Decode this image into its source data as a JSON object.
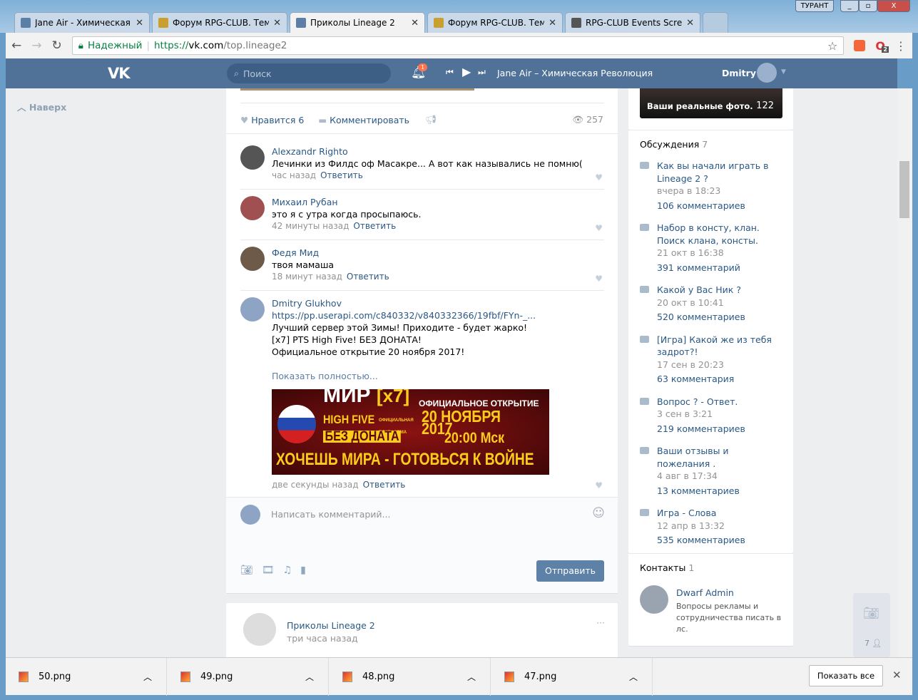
{
  "window": {
    "badge": "ТУРАНТ",
    "min": "_",
    "max": "▫",
    "close": "X"
  },
  "tabs": [
    {
      "title": "Jane Air - Химическая Р",
      "close": "✕"
    },
    {
      "title": "Форум RPG-CLUB. Тема",
      "close": "✕"
    },
    {
      "title": "Приколы Lineage 2",
      "close": "✕"
    },
    {
      "title": "Форум RPG-CLUB. Тема",
      "close": "✕"
    },
    {
      "title": "RPG-CLUB Events Screen",
      "close": "✕"
    }
  ],
  "address": {
    "secure_label": "Надежный",
    "url_scheme": "https://",
    "url_host": "vk.com",
    "url_path": "/top.lineage2",
    "ext_badge": "2"
  },
  "vk": {
    "logo": "VK",
    "search_placeholder": "Поиск",
    "notif_count": "1",
    "track": "Jane Air – Химическая Революция",
    "user": "Dmitry",
    "back_to_top": "Наверх"
  },
  "post": {
    "like_label": "Нравится",
    "like_count": "6",
    "comment_label": "Комментировать",
    "views": "257"
  },
  "comments": [
    {
      "name": "Alexzandr Righto",
      "text": "Лечинки из Филдс оф Масакре... А вот как назывались не помню(",
      "time": "час назад",
      "reply": "Ответить"
    },
    {
      "name": "Михаил Рубан",
      "text": "это я с утра когда просыпаюсь.",
      "time": "42 минуты назад",
      "reply": "Ответить"
    },
    {
      "name": "Федя Мид",
      "text": "твоя мамаша",
      "time": "18 минут назад",
      "reply": "Ответить"
    },
    {
      "name": "Dmitry Glukhov",
      "link": "https://pp.userapi.com/c840332/v840332366/19fbf/FYn-_...",
      "lines": [
        "Лучший сервер этой Зимы! Приходите - будет жарко!",
        "[x7] PTS High Five! БЕЗ ДОНАТА!",
        "Официальное открытие 20 ноября 2017!"
      ],
      "more": "Показать полностью...",
      "time": "две секунды назад",
      "reply": "Ответить"
    }
  ],
  "banner": {
    "mir": "МИР",
    "x7": "[x7]",
    "hf": "HIGH FIVE",
    "platform": "ОФИЦИАЛЬНАЯ ПЛАТФОРМА",
    "nodonate": "БЕЗ ДОНАТА",
    "opening": "ОФИЦИАЛЬНОЕ ОТКРЫТИЕ",
    "date": "20 НОЯБРЯ 2017",
    "time": "20:00 Мск",
    "slogan": "ХОЧЕШЬ МИРА - ГОТОВЬСЯ К ВОЙНЕ"
  },
  "composer": {
    "placeholder": "Написать комментарий...",
    "send": "Отправить"
  },
  "next_post": {
    "author": "Приколы Lineage 2",
    "time": "три часа назад",
    "menu": "···"
  },
  "album": {
    "title": "Ваши реальные фото.",
    "count": "122"
  },
  "discussions": {
    "title": "Обсуждения",
    "count": "7",
    "items": [
      {
        "title": "Как вы начали играть в Lineage 2 ?",
        "date": "вчера в 18:23",
        "comments": "106 комментариев"
      },
      {
        "title": "Набор в консту, клан. Поиск клана, консты.",
        "date": "21 окт в 16:38",
        "comments": "391 комментарий"
      },
      {
        "title": "Какой у Вас Ник ?",
        "date": "20 окт в 10:41",
        "comments": "520 комментариев"
      },
      {
        "title": "[Игра] Какой же из тебя задрот?!",
        "date": "17 сен в 20:23",
        "comments": "63 комментария"
      },
      {
        "title": "Вопрос ? - Ответ.",
        "date": "3 сен в 3:21",
        "comments": "219 комментариев"
      },
      {
        "title": "Ваши отзывы и пожелания .",
        "date": "4 авг в 17:34",
        "comments": "13 комментариев"
      },
      {
        "title": "Игра - Слова",
        "date": "12 апр в 13:32",
        "comments": "535 комментариев"
      }
    ]
  },
  "contacts": {
    "title": "Контакты",
    "count": "1",
    "name": "Dwarf Admin",
    "desc": "Вопросы рекламы и сотрудничества писать в лс."
  },
  "side_widget": {
    "count": "7"
  },
  "downloads": {
    "items": [
      "50.png",
      "49.png",
      "48.png",
      "47.png"
    ],
    "show_all": "Показать все",
    "close": "✕"
  }
}
